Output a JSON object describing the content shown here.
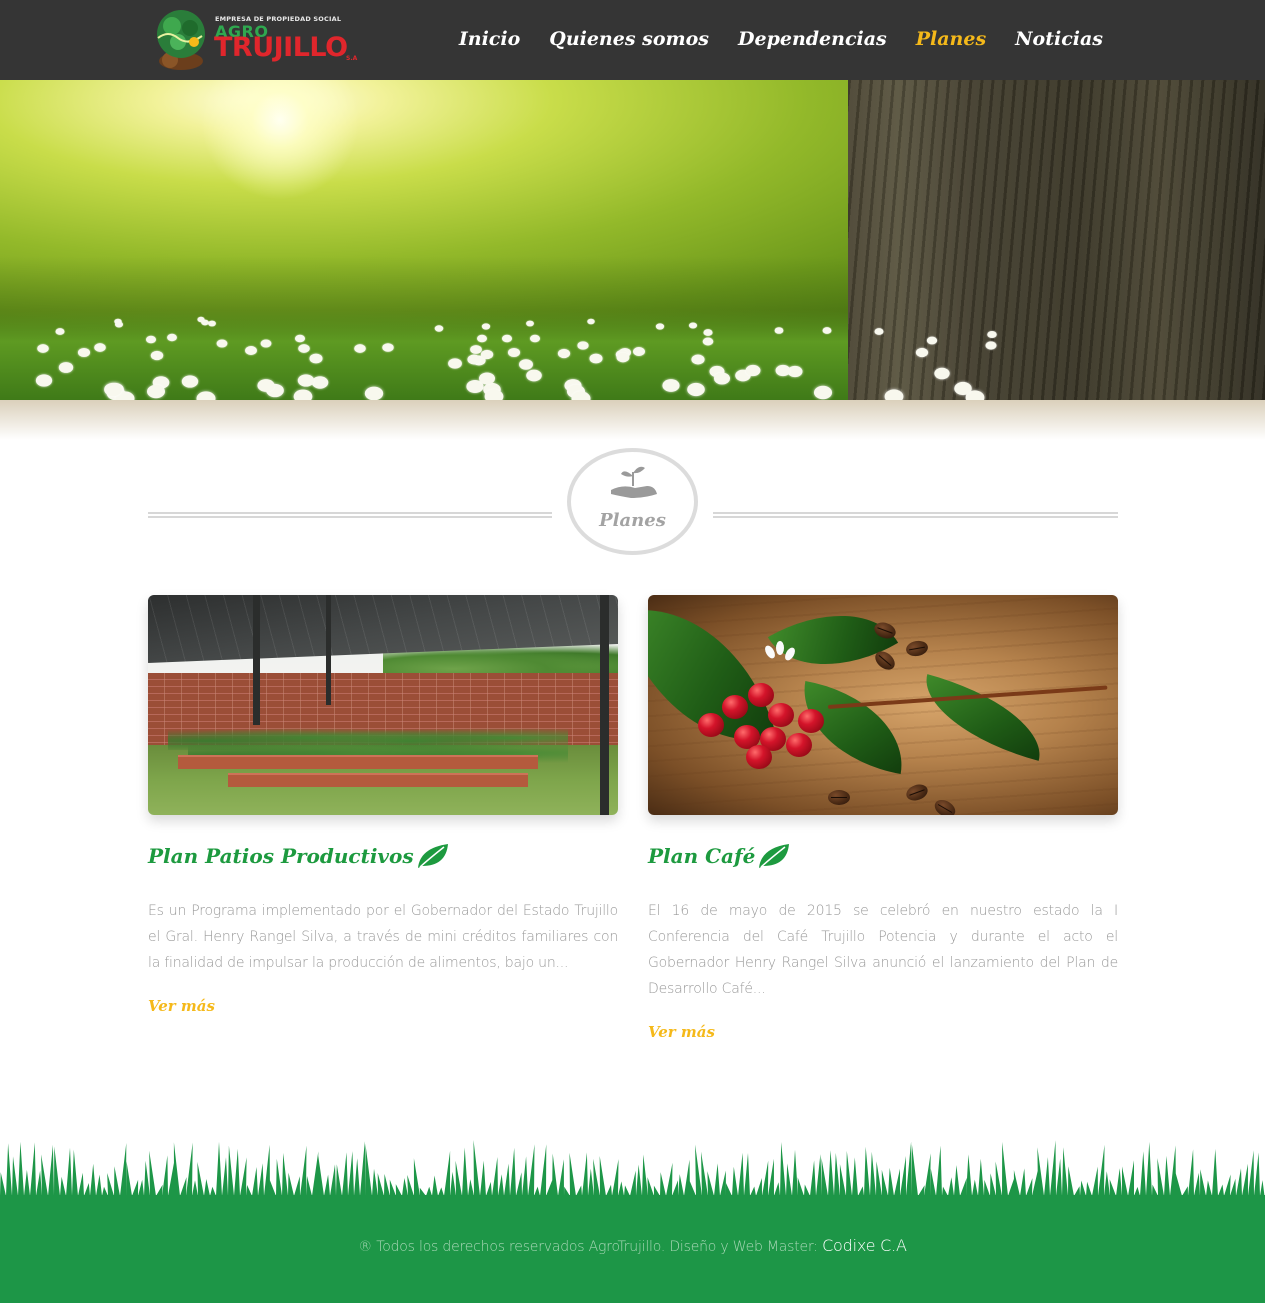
{
  "header": {
    "logo": {
      "tagline": "EMPRESA DE PROPIEDAD SOCIAL",
      "name_top": "AGRO",
      "name_main": "TRUJILLO",
      "suffix": "S.A"
    },
    "nav": [
      {
        "label": "Inicio",
        "active": false
      },
      {
        "label": "Quienes somos",
        "active": false
      },
      {
        "label": "Dependencias",
        "active": false
      },
      {
        "label": "Planes",
        "active": true
      },
      {
        "label": "Noticias",
        "active": false
      }
    ]
  },
  "section": {
    "title": "Planes",
    "icon": "hand-sprout-icon"
  },
  "cards": [
    {
      "title": "Plan Patios Productivos",
      "icon": "leaf-icon",
      "image": "nursery-greenhouse-photo",
      "text": "Es un Programa implementado por el Gobernador del Estado Trujillo el Gral. Henry Rangel Silva, a través de mini créditos familiares con la finalidad de impulsar la producción de alimentos, bajo un...",
      "more": "Ver más"
    },
    {
      "title": "Plan Café",
      "icon": "leaf-icon",
      "image": "coffee-cherries-photo",
      "text": "El 16 de mayo de 2015 se celebró en nuestro estado la I Conferencia del Café Trujillo Potencia y durante el acto el Gobernador Henry Rangel Silva anunció el lanzamiento del Plan de Desarrollo Café...",
      "more": "Ver más"
    }
  ],
  "footer": {
    "text": "® Todos los derechos reservados AgroTrujillo. Diseño y Web Master:",
    "brand": "Codixe C.A"
  },
  "colors": {
    "header_bg": "#353535",
    "accent_yellow": "#f5b91a",
    "brand_green": "#1d9a3f",
    "footer_green": "#1d9647"
  }
}
